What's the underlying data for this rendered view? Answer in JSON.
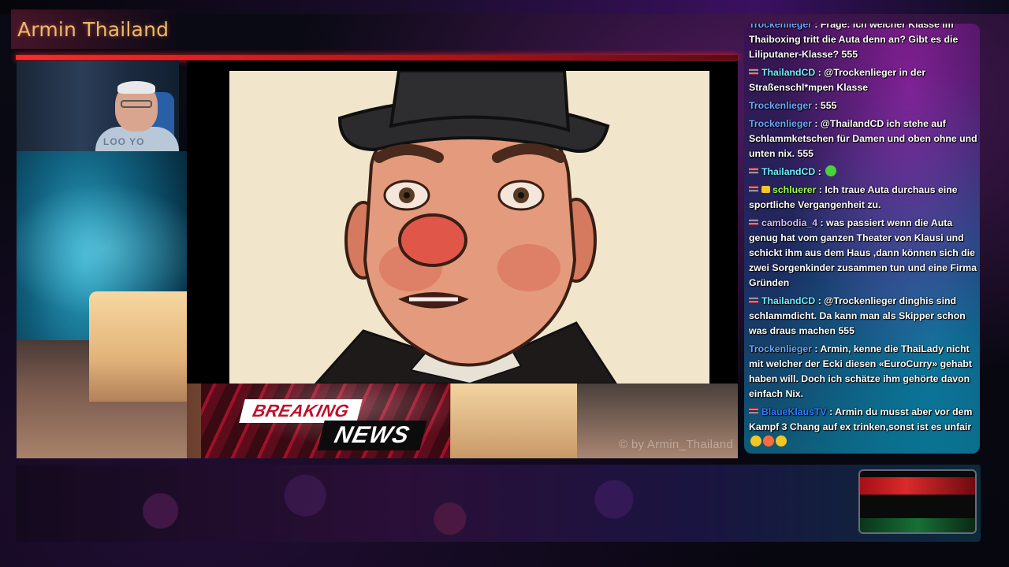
{
  "stream": {
    "title": "Armin Thailand",
    "watermark": "© by Armin_Thailand"
  },
  "webcam": {
    "shirt_text": "LOO YO"
  },
  "breaking_news": {
    "line1": "BREAKING",
    "line2": "NEWS"
  },
  "chat": {
    "messages": [
      {
        "user": "Trockenlieger",
        "user_color": "#6aa8ff",
        "flag": false,
        "badge": false,
        "text": "Frage: Ich welcher Klasse im Thaiboxing tritt die Auta denn an? Gibt es die Liliputaner-Klasse? 555"
      },
      {
        "user": "ThailandCD",
        "user_color": "#6ff0ff",
        "flag": true,
        "badge": false,
        "text": "@Trockenlieger in der Straßenschl*mpen Klasse"
      },
      {
        "user": "Trockenlieger",
        "user_color": "#6aa8ff",
        "flag": false,
        "badge": false,
        "text": "555"
      },
      {
        "user": "Trockenlieger",
        "user_color": "#6aa8ff",
        "flag": false,
        "badge": false,
        "text": "@ThailandCD ich stehe auf Schlammketschen für Damen und oben ohne und unten nix. 555"
      },
      {
        "user": "ThailandCD",
        "user_color": "#6ff0ff",
        "flag": true,
        "badge": false,
        "text": ""
      },
      {
        "user": "schluerer",
        "user_color": "#9dff4a",
        "flag": true,
        "badge": true,
        "text": "Ich traue Auta durchaus eine sportliche Vergangenheit zu."
      },
      {
        "user": "cambodia_4",
        "user_color": "#d9b8ff",
        "flag": true,
        "badge": false,
        "text": "was passiert wenn die Auta genug hat vom ganzen Theater von Klausi und schickt ihm aus dem Haus ,dann können sich die zwei Sorgenkinder zusammen tun und eine Firma Gründen"
      },
      {
        "user": "ThailandCD",
        "user_color": "#6ff0ff",
        "flag": true,
        "badge": false,
        "text": "@Trockenlieger dinghis sind schlammdicht. Da kann man als Skipper schon was draus machen 555"
      },
      {
        "user": "Trockenlieger",
        "user_color": "#6aa8ff",
        "flag": false,
        "badge": false,
        "text": "Armin, kenne die ThaiLady nicht mit welcher der Ecki diesen «EuroCurry» gehabt haben will. Doch ich schätze ihm gehörte davon einfach Nix."
      },
      {
        "user": "BlaueKlausTV",
        "user_color": "#2f7cff",
        "flag": true,
        "badge": false,
        "text": "Armin du musst aber vor dem Kampf 3 Chang auf ex trinken,sonst ist es unfair"
      }
    ]
  },
  "colors": {
    "title": "#f2b868",
    "red_line": "#ff2a2a",
    "breaking_red": "#c0102a"
  }
}
